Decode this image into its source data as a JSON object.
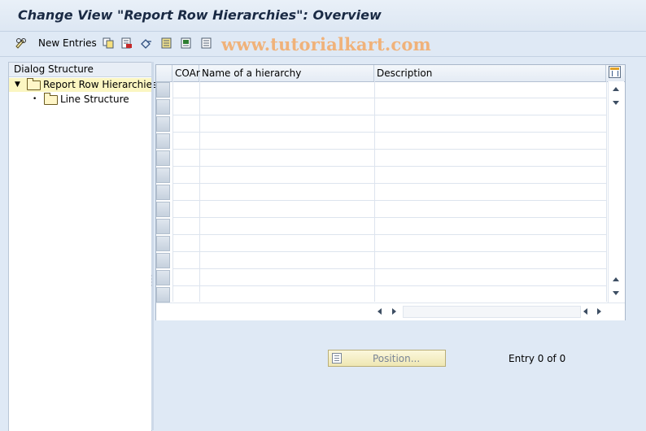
{
  "window": {
    "title": "Change View \"Report Row Hierarchies\": Overview"
  },
  "toolbar": {
    "new_entries_label": "New Entries",
    "icons": [
      "glasses-edit-icon",
      "copy-icon",
      "delete-icon",
      "undo-icon",
      "select-all-icon",
      "select-block-icon",
      "deselect-all-icon"
    ]
  },
  "watermark": "www.tutorialkart.com",
  "dialog_structure": {
    "header": "Dialog Structure",
    "items": [
      {
        "label": "Report Row Hierarchies",
        "selected": true,
        "expanded": true
      },
      {
        "label": "Line Structure",
        "selected": false
      }
    ]
  },
  "table": {
    "columns": [
      "COAr",
      "Name of a hierarchy",
      "Description"
    ],
    "rows": []
  },
  "footer": {
    "position_button": "Position...",
    "entry_text": "Entry 0 of 0"
  },
  "colors": {
    "background": "#dfe9f5",
    "selected_tree": "#fbf6c2",
    "watermark": "#f0b27a"
  }
}
